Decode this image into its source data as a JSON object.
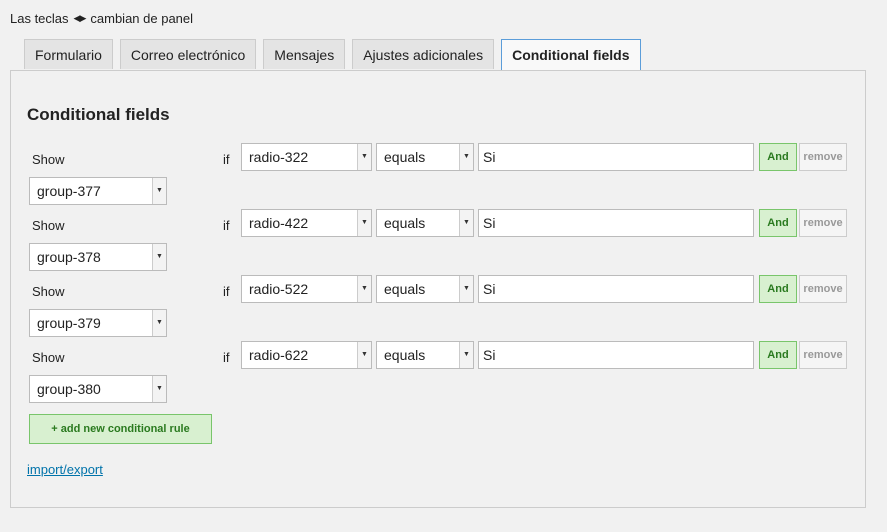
{
  "hint": {
    "before": "Las teclas",
    "arrows_icon": "left-right-arrows-icon",
    "after": "cambian de panel"
  },
  "tabs": [
    {
      "label": "Formulario",
      "active": false
    },
    {
      "label": "Correo electrónico",
      "active": false
    },
    {
      "label": "Mensajes",
      "active": false
    },
    {
      "label": "Ajustes adicionales",
      "active": false
    },
    {
      "label": "Conditional fields",
      "active": true
    }
  ],
  "panel": {
    "title": "Conditional fields",
    "rules": [
      {
        "show_label": "Show",
        "group": "group-377",
        "if_label": "if",
        "field": "radio-322",
        "operator": "equals",
        "value": "Si",
        "and_label": "And",
        "remove_label": "remove"
      },
      {
        "show_label": "Show",
        "group": "group-378",
        "if_label": "if",
        "field": "radio-422",
        "operator": "equals",
        "value": "Si",
        "and_label": "And",
        "remove_label": "remove"
      },
      {
        "show_label": "Show",
        "group": "group-379",
        "if_label": "if",
        "field": "radio-522",
        "operator": "equals",
        "value": "Si",
        "and_label": "And",
        "remove_label": "remove"
      },
      {
        "show_label": "Show",
        "group": "group-380",
        "if_label": "if",
        "field": "radio-622",
        "operator": "equals",
        "value": "Si",
        "and_label": "And",
        "remove_label": "remove"
      }
    ],
    "add_rule_label": "+ add new conditional rule",
    "import_export_label": "import/export"
  },
  "colors": {
    "accent_green": "#79c56b",
    "link": "#0073aa",
    "active_tab_border": "#5b9dd9"
  }
}
